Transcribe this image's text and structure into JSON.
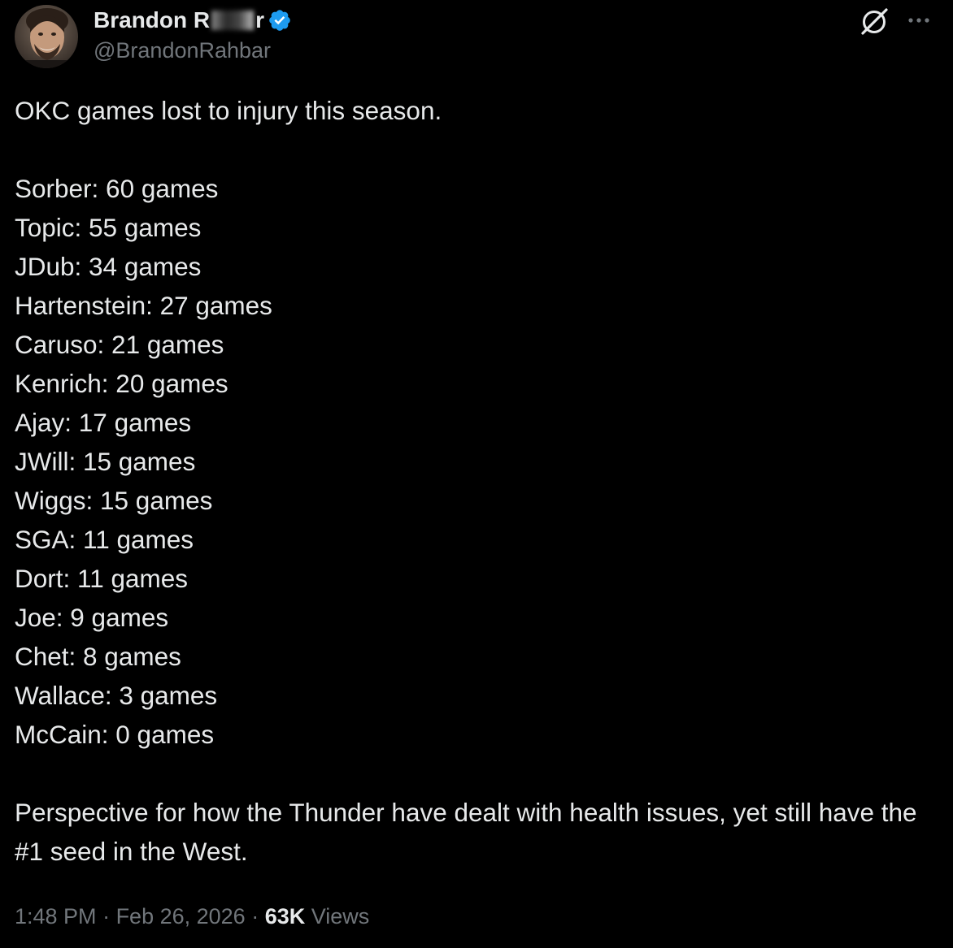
{
  "author": {
    "display_name_visible": "Brandon R",
    "display_name_tail": "r",
    "handle": "@BrandonRahbar",
    "verified": true,
    "verified_color": "#1d9bf0"
  },
  "actions": {
    "grok_icon": "grok-icon",
    "more_icon": "more-icon"
  },
  "tweet": {
    "intro": "OKC games lost to injury this season.",
    "items": [
      "Sorber: 60 games",
      "Topic: 55 games",
      "JDub: 34 games",
      "Hartenstein: 27 games",
      "Caruso: 21 games",
      "Kenrich: 20 games",
      "Ajay: 17 games",
      "JWill: 15 games",
      "Wiggs: 15 games",
      "SGA: 11 games",
      "Dort: 11 games",
      "Joe: 9 games",
      "Chet: 8 games",
      "Wallace: 3 games",
      "McCain: 0 games"
    ],
    "closing": "Perspective for how the Thunder have dealt with health issues, yet still have the #1 seed in the West."
  },
  "meta": {
    "time": "1:48 PM",
    "separator": " · ",
    "date": "Feb 26, 2026",
    "views_count": "63K",
    "views_label": " Views"
  },
  "colors": {
    "background": "#000000",
    "text": "#e7e9ea",
    "secondary": "#71767b"
  }
}
